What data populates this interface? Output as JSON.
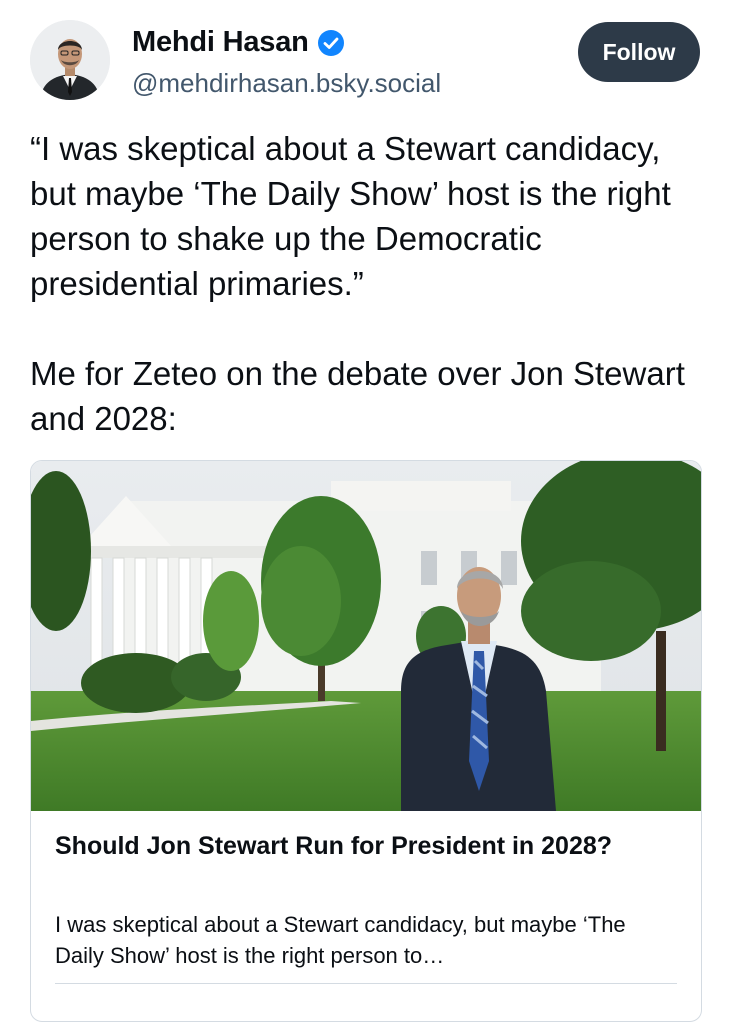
{
  "author": {
    "display_name": "Mehdi Hasan",
    "handle": "@mehdirhasan.bsky.social",
    "verified": true
  },
  "follow_button": {
    "label": "Follow"
  },
  "post": {
    "text": "“I was skeptical about a Stewart candidacy, but maybe ‘The Daily Show’ host is the right person to shake up the Democratic presidential primaries.”\n\nMe for Zeteo on the debate over Jon Stewart and 2028:"
  },
  "link_card": {
    "title": "Should Jon Stewart Run for President in 2028?",
    "description": "I was skeptical about a Stewart candidacy, but maybe ‘The Daily Show’ host is the right person to…"
  },
  "colors": {
    "follow_bg": "#2d3a48",
    "verified_badge": "#1185fe",
    "handle_text": "#42576c",
    "card_border": "#d4dbe2"
  },
  "icons": {
    "verified": "verified-check-icon"
  }
}
